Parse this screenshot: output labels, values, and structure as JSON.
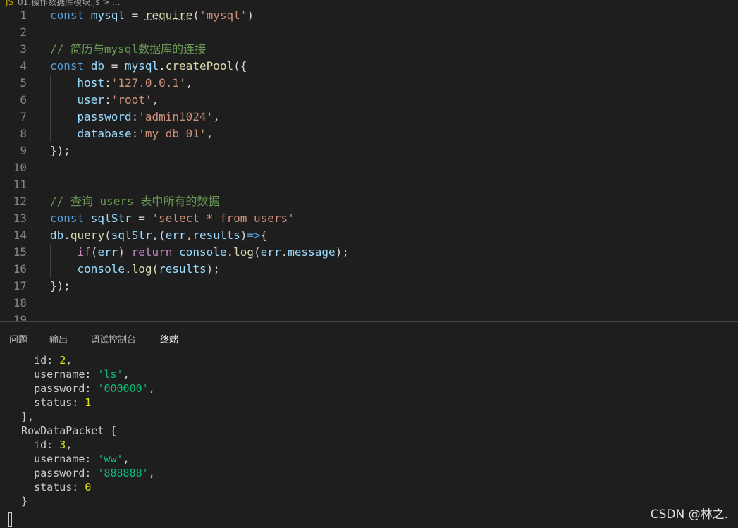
{
  "breadcrumb": "01.操作数据库模块.js > ...",
  "editor": {
    "lines": [
      {
        "n": "1",
        "tokens": [
          [
            "kw",
            "const "
          ],
          [
            "var",
            "mysql"
          ],
          [
            "pn",
            " = "
          ],
          [
            "fn dotted",
            "require"
          ],
          [
            "pn",
            "("
          ],
          [
            "str",
            "'mysql'"
          ],
          [
            "pn",
            ")"
          ]
        ]
      },
      {
        "n": "2",
        "tokens": []
      },
      {
        "n": "3",
        "tokens": [
          [
            "cm",
            "// 简历与mysql数据库的连接"
          ]
        ]
      },
      {
        "n": "4",
        "tokens": [
          [
            "kw",
            "const "
          ],
          [
            "var",
            "db"
          ],
          [
            "pn",
            " = "
          ],
          [
            "var",
            "mysql"
          ],
          [
            "pn",
            "."
          ],
          [
            "fn",
            "createPool"
          ],
          [
            "pn",
            "({"
          ]
        ]
      },
      {
        "n": "5",
        "tokens": [
          [
            "pn",
            "    "
          ],
          [
            "var",
            "host"
          ],
          [
            "pn",
            ":"
          ],
          [
            "str",
            "'127.0.0.1'"
          ],
          [
            "pn",
            ","
          ]
        ]
      },
      {
        "n": "6",
        "tokens": [
          [
            "pn",
            "    "
          ],
          [
            "var",
            "user"
          ],
          [
            "pn",
            ":"
          ],
          [
            "str",
            "'root'"
          ],
          [
            "pn",
            ","
          ]
        ]
      },
      {
        "n": "7",
        "tokens": [
          [
            "pn",
            "    "
          ],
          [
            "var",
            "password"
          ],
          [
            "pn",
            ":"
          ],
          [
            "str",
            "'admin1024'"
          ],
          [
            "pn",
            ","
          ]
        ]
      },
      {
        "n": "8",
        "tokens": [
          [
            "pn",
            "    "
          ],
          [
            "var",
            "database"
          ],
          [
            "pn",
            ":"
          ],
          [
            "str",
            "'my_db_01'"
          ],
          [
            "pn",
            ","
          ]
        ]
      },
      {
        "n": "9",
        "tokens": [
          [
            "pn",
            "});"
          ]
        ]
      },
      {
        "n": "10",
        "tokens": []
      },
      {
        "n": "11",
        "tokens": []
      },
      {
        "n": "12",
        "tokens": [
          [
            "cm",
            "// 查询 users 表中所有的数据"
          ]
        ]
      },
      {
        "n": "13",
        "tokens": [
          [
            "kw",
            "const "
          ],
          [
            "var",
            "sqlStr"
          ],
          [
            "pn",
            " = "
          ],
          [
            "str",
            "'select * from users'"
          ]
        ]
      },
      {
        "n": "14",
        "tokens": [
          [
            "var",
            "db"
          ],
          [
            "pn",
            "."
          ],
          [
            "fn",
            "query"
          ],
          [
            "pn",
            "("
          ],
          [
            "var",
            "sqlStr"
          ],
          [
            "pn",
            ",("
          ],
          [
            "var",
            "err"
          ],
          [
            "pn",
            ","
          ],
          [
            "var",
            "results"
          ],
          [
            "pn",
            ")"
          ],
          [
            "kw",
            "=>"
          ],
          [
            "pn",
            "{"
          ]
        ]
      },
      {
        "n": "15",
        "tokens": [
          [
            "pn",
            "    "
          ],
          [
            "ctl",
            "if"
          ],
          [
            "pn",
            "("
          ],
          [
            "var",
            "err"
          ],
          [
            "pn",
            ") "
          ],
          [
            "ctl",
            "return "
          ],
          [
            "var",
            "console"
          ],
          [
            "pn",
            "."
          ],
          [
            "fn",
            "log"
          ],
          [
            "pn",
            "("
          ],
          [
            "var",
            "err"
          ],
          [
            "pn",
            "."
          ],
          [
            "var",
            "message"
          ],
          [
            "pn",
            ");"
          ]
        ]
      },
      {
        "n": "16",
        "tokens": [
          [
            "pn",
            "    "
          ],
          [
            "var",
            "console"
          ],
          [
            "pn",
            "."
          ],
          [
            "fn",
            "log"
          ],
          [
            "pn",
            "("
          ],
          [
            "var",
            "results"
          ],
          [
            "pn",
            ");"
          ]
        ]
      },
      {
        "n": "17",
        "tokens": [
          [
            "pn",
            "});"
          ]
        ]
      },
      {
        "n": "18",
        "tokens": []
      },
      {
        "n": "19",
        "tokens": []
      }
    ]
  },
  "panel": {
    "tabs": [
      {
        "label": "问题",
        "active": false
      },
      {
        "label": "输出",
        "active": false
      },
      {
        "label": "调试控制台",
        "active": false
      },
      {
        "label": "终端",
        "active": true
      }
    ]
  },
  "terminal": {
    "lines": [
      [
        [
          "p",
          "    id: "
        ],
        [
          "n",
          "2"
        ],
        [
          "p",
          ","
        ]
      ],
      [
        [
          "p",
          "    username: "
        ],
        [
          "s",
          "'ls'"
        ],
        [
          "p",
          ","
        ]
      ],
      [
        [
          "p",
          "    password: "
        ],
        [
          "s",
          "'000000'"
        ],
        [
          "p",
          ","
        ]
      ],
      [
        [
          "p",
          "    status: "
        ],
        [
          "n",
          "1"
        ]
      ],
      [
        [
          "p",
          "  },"
        ]
      ],
      [
        [
          "p",
          "  RowDataPacket {"
        ]
      ],
      [
        [
          "p",
          "    id: "
        ],
        [
          "n",
          "3"
        ],
        [
          "p",
          ","
        ]
      ],
      [
        [
          "p",
          "    username: "
        ],
        [
          "s",
          "'ww'"
        ],
        [
          "p",
          ","
        ]
      ],
      [
        [
          "p",
          "    password: "
        ],
        [
          "s",
          "'888888'"
        ],
        [
          "p",
          ","
        ]
      ],
      [
        [
          "p",
          "    status: "
        ],
        [
          "n",
          "0"
        ]
      ],
      [
        [
          "p",
          "  }"
        ]
      ]
    ]
  },
  "watermark": "CSDN @林之."
}
